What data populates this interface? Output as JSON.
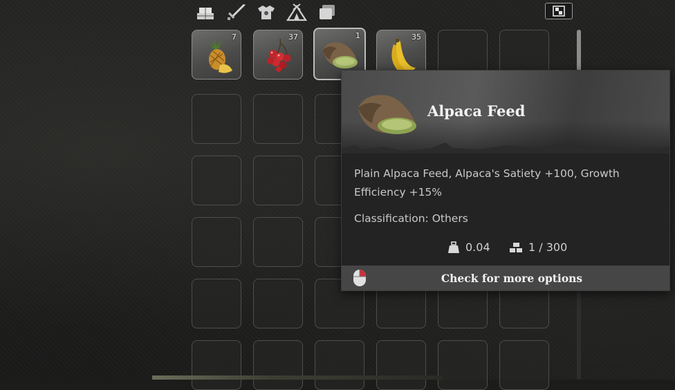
{
  "tabs": [
    {
      "name": "materials-tab"
    },
    {
      "name": "weapons-tab"
    },
    {
      "name": "armor-tab"
    },
    {
      "name": "camp-tab"
    },
    {
      "name": "others-tab"
    }
  ],
  "inventory": {
    "slots": [
      {
        "item": "pineapple",
        "qty": "7"
      },
      {
        "item": "berries",
        "qty": "37"
      },
      {
        "item": "alpaca-feed",
        "qty": "1"
      },
      {
        "item": "banana",
        "qty": "35"
      }
    ]
  },
  "tooltip": {
    "title": "Alpaca Feed",
    "description": "Plain Alpaca Feed, Alpaca's Satiety +100, Growth Efficiency +15%",
    "classification": "Classification: Others",
    "weight": "0.04",
    "stack": "1 / 300",
    "footer_action": "Check for more options"
  },
  "colors": {
    "tooltip_bg": "#232323",
    "footer_bg": "#464646",
    "slot_border": "#4e4e4c"
  }
}
